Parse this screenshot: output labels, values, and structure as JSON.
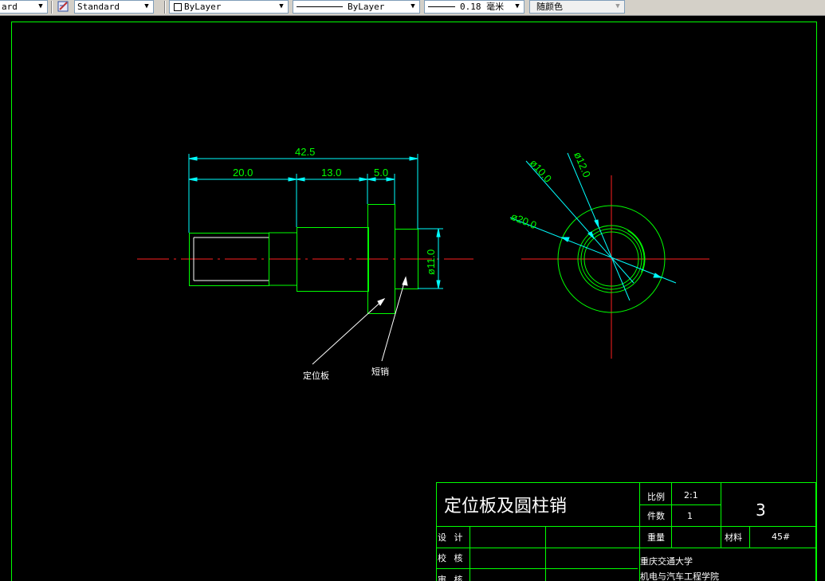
{
  "toolbar": {
    "text_style_partial": "ard",
    "dim_style": "Standard",
    "layer": "ByLayer",
    "linetype": "ByLayer",
    "lineweight": "0.18 毫米",
    "color": "随颜色"
  },
  "drawing": {
    "dims": {
      "total_length": "42.5",
      "seg1": "20.0",
      "seg2": "13.0",
      "seg3": "5.0",
      "dia_pin": "ø11.0",
      "dia_10": "ø10.0",
      "dia_12": "ø12.0",
      "dia_20": "ø20.0"
    },
    "leaders": {
      "positioning_plate": "定位板",
      "short_pin": "短销"
    }
  },
  "title_block": {
    "title": "定位板及圆柱销",
    "scale_label": "比例",
    "scale_value": "2:1",
    "count_label": "件数",
    "count_value": "1",
    "sheet_number": "3",
    "design_label": "设 计",
    "check_label": "校 核",
    "review_label": "审 核",
    "weight_label": "重量",
    "material_label": "材料",
    "material_value": "45#",
    "school_line1": "重庆交通大学",
    "school_line2": "机电与汽车工程学院"
  },
  "colors": {
    "background": "#000000",
    "outline": "#00ff00",
    "dimension": "#00ffff",
    "centerline": "#ff0000",
    "text": "#ffffff"
  }
}
